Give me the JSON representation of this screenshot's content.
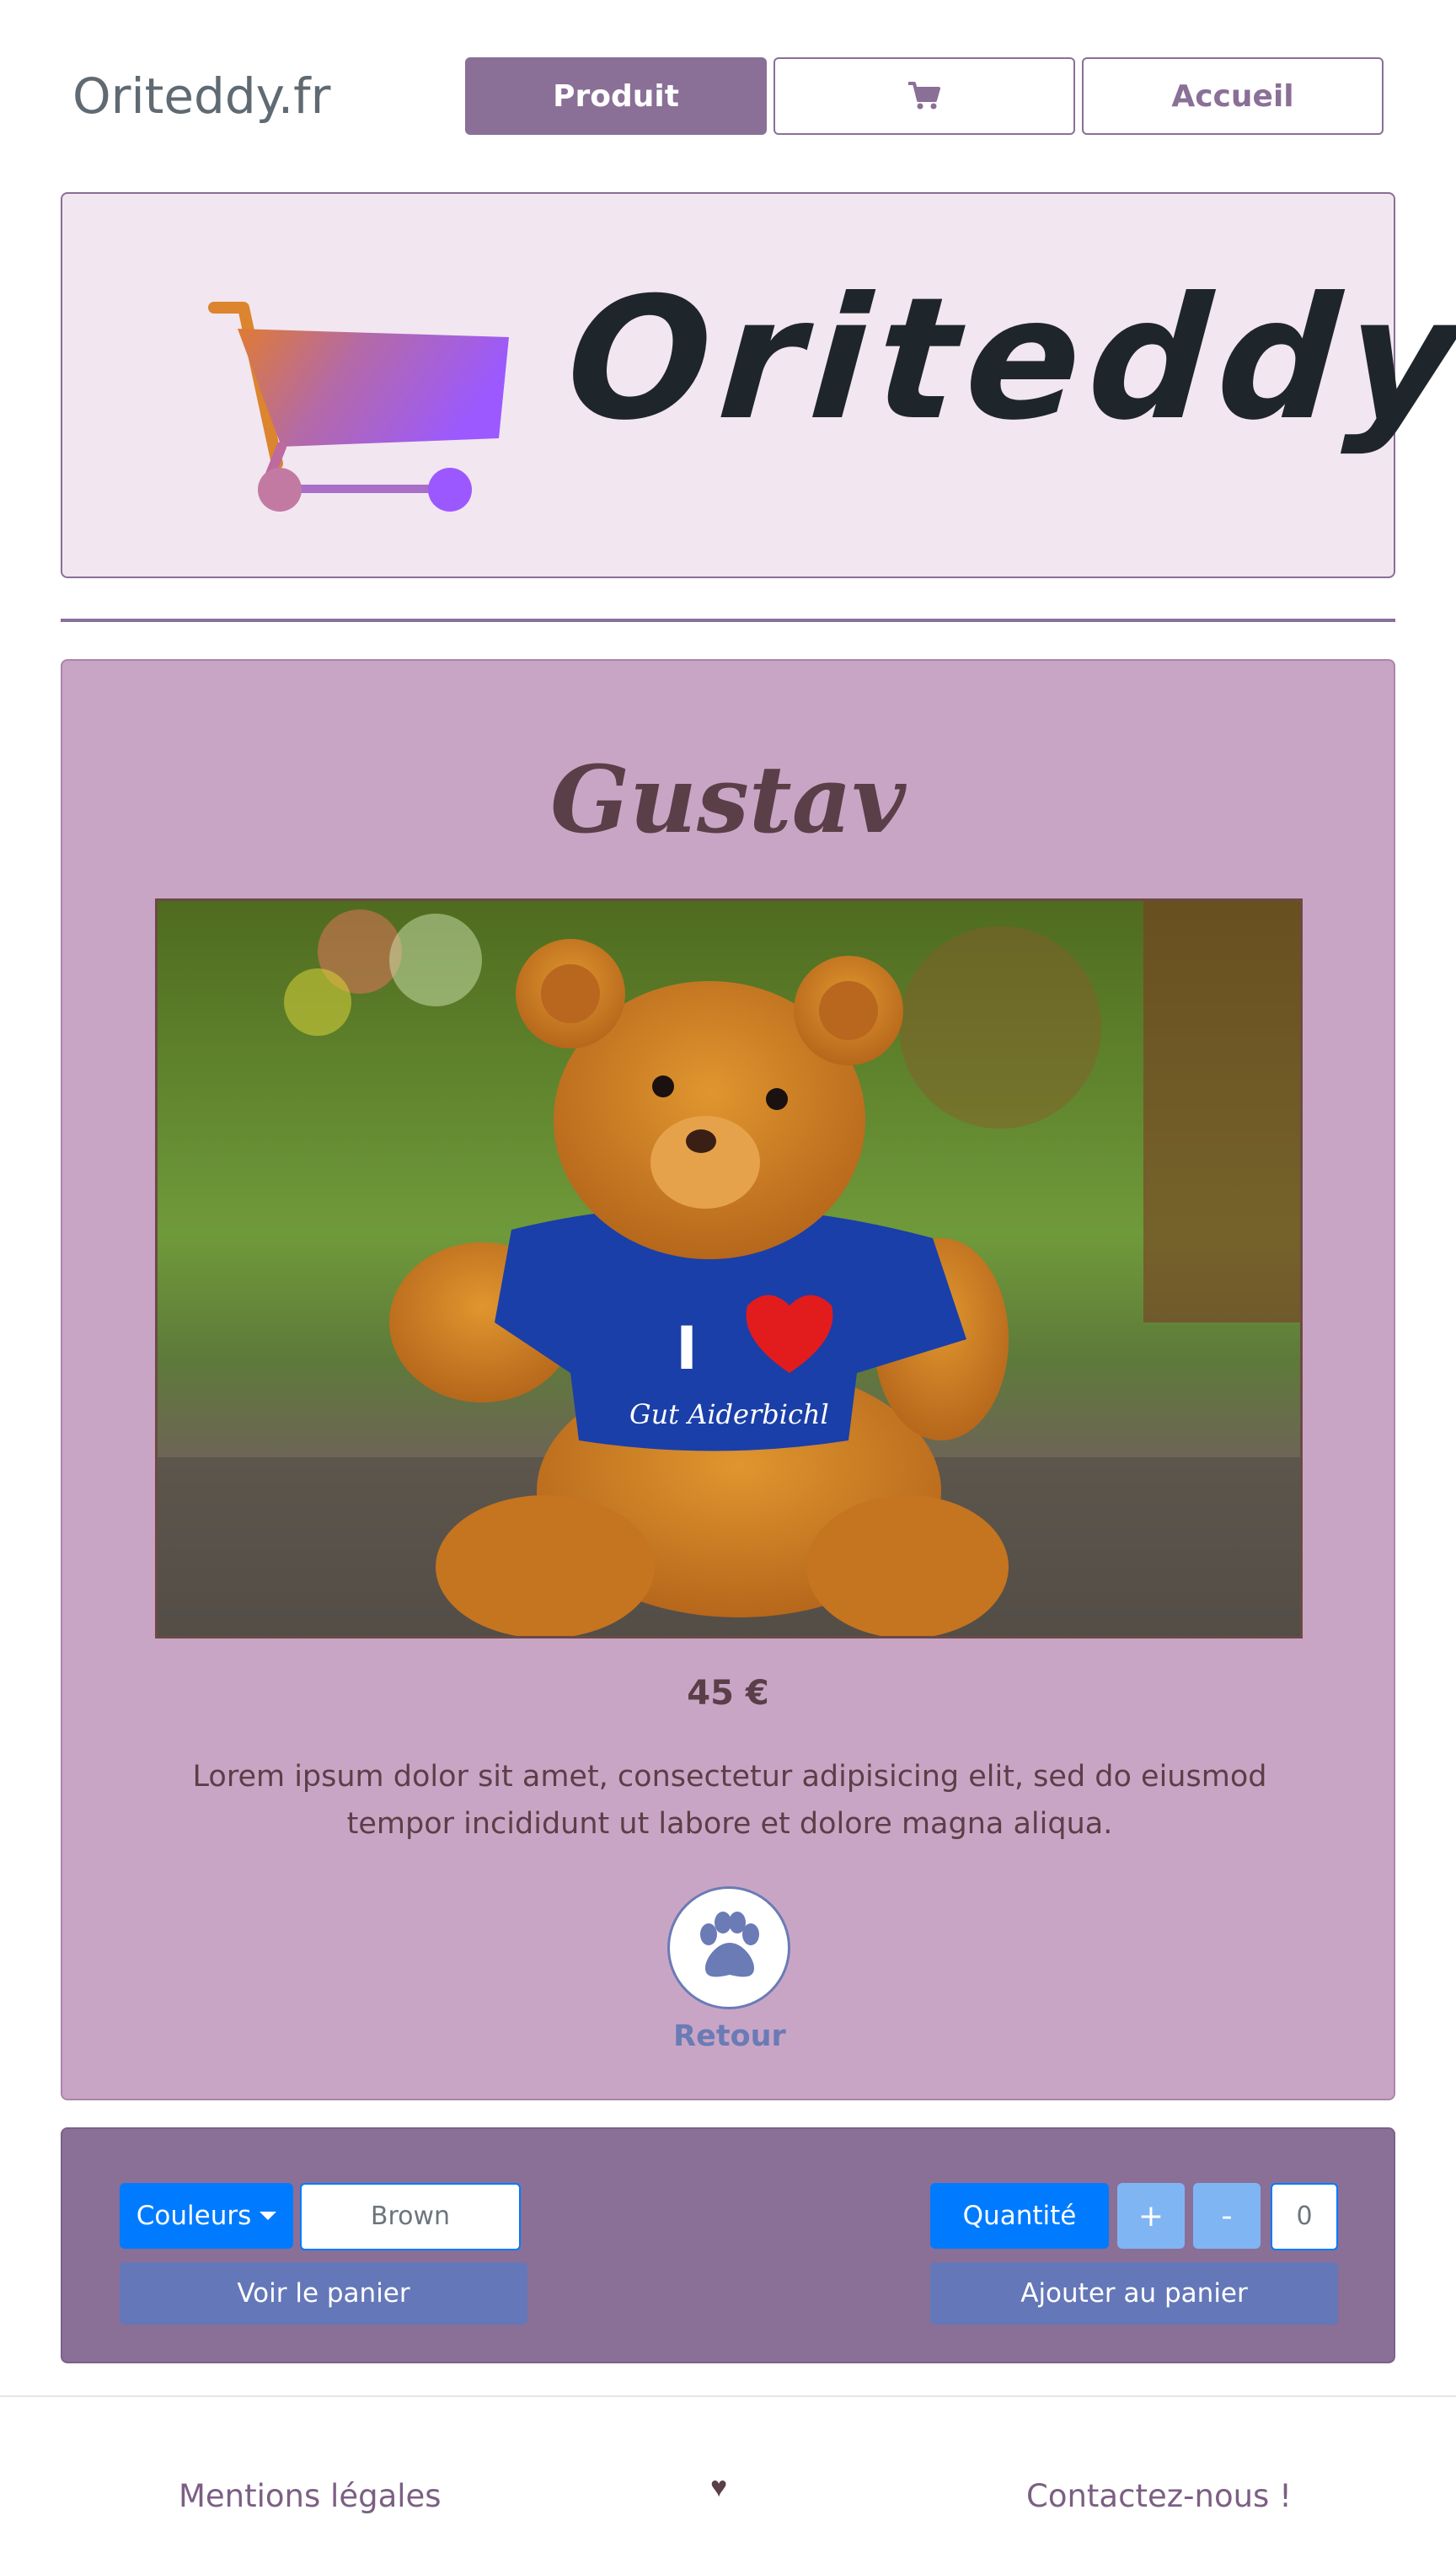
{
  "navbar": {
    "brand": "Oriteddy.fr",
    "buttons": [
      {
        "label": "Produit",
        "active": true
      },
      {
        "label": "",
        "icon": "cart-icon"
      },
      {
        "label": "Accueil",
        "active": false
      }
    ]
  },
  "hero": {
    "logo_icon": "shopping-cart-icon",
    "title": "Oriteddy"
  },
  "product": {
    "name": "Gustav",
    "image_icon": "teddy-bear-photo",
    "price": "45 €",
    "description": "Lorem ipsum dolor sit amet, consectetur adipisicing elit, sed do eiusmod tempor incididunt ut labore et dolore magna aliqua.",
    "back_icon": "paw-icon",
    "back_label": "Retour"
  },
  "controls": {
    "colors_label": "Couleurs",
    "selected_color": "Brown",
    "quantity_label": "Quantité",
    "plus_label": "+",
    "minus_label": "-",
    "quantity_value": "0",
    "view_cart_label": "Voir le panier",
    "add_to_cart_label": "Ajouter au panier"
  },
  "footer": {
    "legal": "Mentions légales",
    "heart": "♥",
    "contact": "Contactez-nous !"
  },
  "colors": {
    "primary": "#8a6f97",
    "hero_bg": "#f2e6f0",
    "card_bg": "#c9a5c5",
    "accent_blue": "#007bff",
    "steel_blue": "#6477b9"
  }
}
